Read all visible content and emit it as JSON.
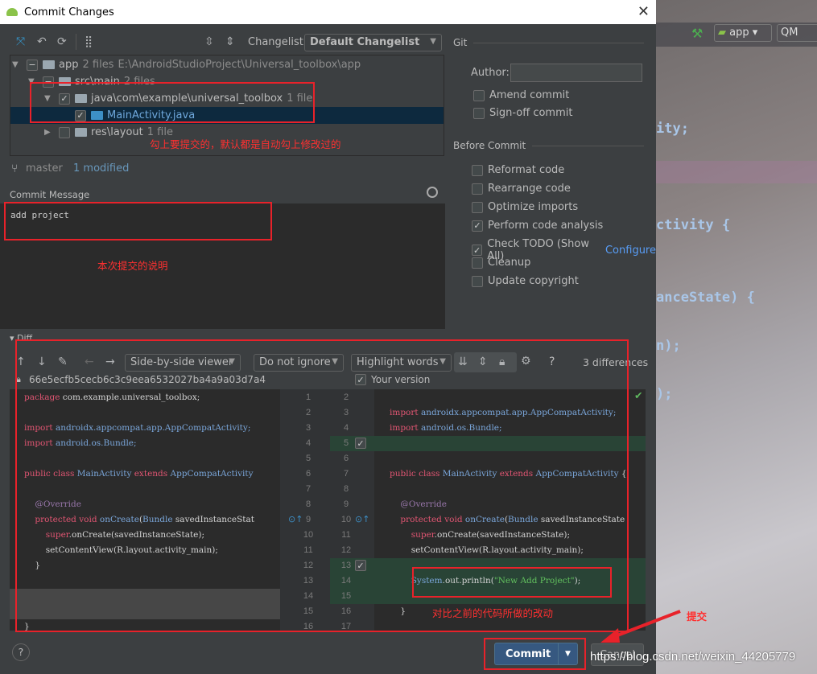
{
  "window": {
    "title": "Commit Changes",
    "close": "✕"
  },
  "background": {
    "run_config": "app",
    "device": "QM",
    "code_frag": [
      "ity;",
      "ctivity {",
      "anceState) {",
      "n);",
      ");"
    ]
  },
  "changes_toolbar": {
    "changelist_label": "Changelist:",
    "changelist_value": "Default Changelist"
  },
  "tree": [
    {
      "name": "app",
      "meta": "2 files",
      "path": "E:\\AndroidStudioProject\\Universal_toolbox\\app",
      "check": "partial",
      "expanded": true
    },
    {
      "name": "src\\main",
      "meta": "2 files",
      "check": "partial",
      "expanded": true
    },
    {
      "name": "java\\com\\example\\universal_toolbox",
      "meta": "1 file",
      "check": "checked",
      "expanded": true
    },
    {
      "name": "MainActivity.java",
      "meta": "",
      "check": "checked",
      "selected": true
    },
    {
      "name": "res\\layout",
      "meta": "1 file",
      "check": "unchecked",
      "expanded": false
    }
  ],
  "annotations": {
    "tree_note": "勾上要提交的，默认都是自动勾上修改过的",
    "message_note": "本次提交的说明",
    "diff_note": "对比之前的代码所做的改动",
    "commit_note": "提交"
  },
  "status": {
    "branch": "master",
    "modified": "1 modified"
  },
  "commit_message": {
    "label": "Commit Message",
    "value": "add project"
  },
  "git": {
    "section": "Git",
    "author_label": "Author:",
    "author_value": "",
    "amend": {
      "label": "Amend commit",
      "checked": false
    },
    "signoff": {
      "label": "Sign-off commit",
      "checked": false
    }
  },
  "before_commit": {
    "section": "Before Commit",
    "options": [
      {
        "label": "Reformat code",
        "checked": false
      },
      {
        "label": "Rearrange code",
        "checked": false
      },
      {
        "label": "Optimize imports",
        "checked": false
      },
      {
        "label": "Perform code analysis",
        "checked": true
      },
      {
        "label": "Check TODO (Show All)",
        "checked": true,
        "link": "Configure"
      },
      {
        "label": "Cleanup",
        "checked": false
      },
      {
        "label": "Update copyright",
        "checked": false
      }
    ]
  },
  "diff": {
    "label": "Diff",
    "viewer": "Side-by-side viewer",
    "ignore": "Do not ignore",
    "highlight": "Highlight words",
    "help": "?",
    "count": "3 differences",
    "left_revision": "66e5ecfb5cecb6c3c9eea6532027ba4a9a03d7a4",
    "right_label": "Your version",
    "rows": [
      {
        "ln": "1",
        "rn": "2",
        "l": [
          [
            "kw",
            "package "
          ],
          [
            "pl",
            "com.example.universal_toolbox;"
          ]
        ],
        "r": []
      },
      {
        "ln": "2",
        "rn": "3",
        "l": [],
        "r": [
          [
            "kw",
            "import "
          ],
          [
            "cls",
            "androidx.appcompat.app.AppCompatActivity;"
          ]
        ]
      },
      {
        "ln": "3",
        "rn": "4",
        "l": [
          [
            "kw",
            "import "
          ],
          [
            "cls",
            "androidx.appcompat.app.AppCompatActivity;"
          ]
        ],
        "r": [
          [
            "kw",
            "import "
          ],
          [
            "cls",
            "android.os.Bundle;"
          ]
        ]
      },
      {
        "ln": "4",
        "rn": "5",
        "l": [
          [
            "kw",
            "import "
          ],
          [
            "cls",
            "android.os.Bundle;"
          ]
        ],
        "r": [],
        "rg": true
      },
      {
        "ln": "5",
        "rn": "6",
        "l": [],
        "r": []
      },
      {
        "ln": "6",
        "rn": "7",
        "l": [
          [
            "kw",
            "public class "
          ],
          [
            "cls",
            "MainActivity "
          ],
          [
            "kw",
            "extends "
          ],
          [
            "cls",
            "AppCompatActivity"
          ]
        ],
        "r": [
          [
            "kw",
            "public class "
          ],
          [
            "cls",
            "MainActivity "
          ],
          [
            "kw",
            "extends "
          ],
          [
            "cls",
            "AppCompatActivity "
          ],
          [
            "pl",
            "{"
          ]
        ]
      },
      {
        "ln": "7",
        "rn": "8",
        "l": [],
        "r": []
      },
      {
        "ln": "8",
        "rn": "9",
        "l": [
          [
            "ann",
            "    @Override"
          ]
        ],
        "r": [
          [
            "ann",
            "    @Override"
          ]
        ]
      },
      {
        "ln": "9",
        "rn": "10",
        "l": [
          [
            "kw",
            "    protected void "
          ],
          [
            "cls",
            "onCreate"
          ],
          [
            "pl",
            "("
          ],
          [
            "cls",
            "Bundle "
          ],
          [
            "pl",
            "savedInstanceStat"
          ]
        ],
        "r": [
          [
            "kw",
            "    protected void "
          ],
          [
            "cls",
            "onCreate"
          ],
          [
            "pl",
            "("
          ],
          [
            "cls",
            "Bundle "
          ],
          [
            "pl",
            "savedInstanceState"
          ]
        ]
      },
      {
        "ln": "10",
        "rn": "11",
        "l": [
          [
            "kw",
            "        super"
          ],
          [
            "pl",
            ".onCreate(savedInstanceState);"
          ]
        ],
        "r": [
          [
            "kw",
            "        super"
          ],
          [
            "pl",
            ".onCreate(savedInstanceState);"
          ]
        ]
      },
      {
        "ln": "11",
        "rn": "12",
        "l": [
          [
            "pl",
            "        setContentView(R.layout.activity_main);"
          ]
        ],
        "r": [
          [
            "pl",
            "        setContentView(R.layout.activity_main);"
          ]
        ]
      },
      {
        "ln": "12",
        "rn": "13",
        "l": [
          [
            "pl",
            "    }"
          ]
        ],
        "r": [],
        "rg": true
      },
      {
        "ln": "13",
        "rn": "14",
        "l": [],
        "r": [
          [
            "cls",
            "        System"
          ],
          [
            "pl",
            ".out.println("
          ],
          [
            "str",
            "\"New Add Project\""
          ],
          [
            "pl",
            ");"
          ]
        ],
        "rg": true
      },
      {
        "ln": "14",
        "rn": "15",
        "l": [],
        "r": [],
        "rg": true,
        "lgray": true
      },
      {
        "ln": "15",
        "rn": "16",
        "l": [],
        "r": [
          [
            "pl",
            "    }"
          ]
        ],
        "lgray": true
      },
      {
        "ln": "16",
        "rn": "17",
        "l": [
          [
            "pl",
            "}"
          ]
        ],
        "r": []
      }
    ]
  },
  "footer": {
    "help": "?",
    "commit": "Commit",
    "cancel": "Cancel",
    "watermark": "https://blog.csdn.net/weixin_44205779"
  },
  "colors": {
    "accent": "#365880",
    "annotation_red": "#e8222a",
    "added_bg": "#294436",
    "link": "#589df6"
  }
}
